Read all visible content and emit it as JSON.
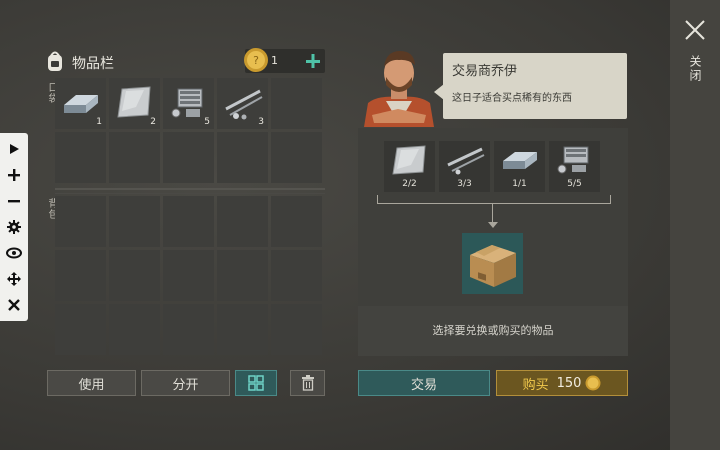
{
  "inventory": {
    "title": "物品栏",
    "coins": "1",
    "pockets_label": "口袋",
    "backpack_label": "背包",
    "pocket_items": [
      {
        "icon": "metal-bar-icon",
        "qty": "1"
      },
      {
        "icon": "metal-plate-icon",
        "qty": "2"
      },
      {
        "icon": "engine-part-icon",
        "qty": "5"
      },
      {
        "icon": "pipe-parts-icon",
        "qty": "3"
      },
      {
        "icon": "",
        "qty": ""
      }
    ]
  },
  "buttons": {
    "use": "使用",
    "split": "分开",
    "trade": "交易",
    "buy_label": "购买",
    "buy_price": "150"
  },
  "trader": {
    "name": "交易商乔伊",
    "line": "这日子适合买点稀有的东西"
  },
  "trade": {
    "required": [
      {
        "icon": "metal-plate-icon",
        "count": "2/2"
      },
      {
        "icon": "pipe-parts-icon",
        "count": "3/3"
      },
      {
        "icon": "metal-bar-icon",
        "count": "1/1"
      },
      {
        "icon": "engine-part-icon",
        "count": "5/5"
      }
    ],
    "reward_icon": "cardboard-box-icon",
    "hint": "选择要兑换或购买的物品"
  },
  "close_label": "关闭",
  "colors": {
    "teal": "#2f5a5a",
    "gold": "#f2c94c",
    "accent_plus": "#4fc3a8"
  }
}
